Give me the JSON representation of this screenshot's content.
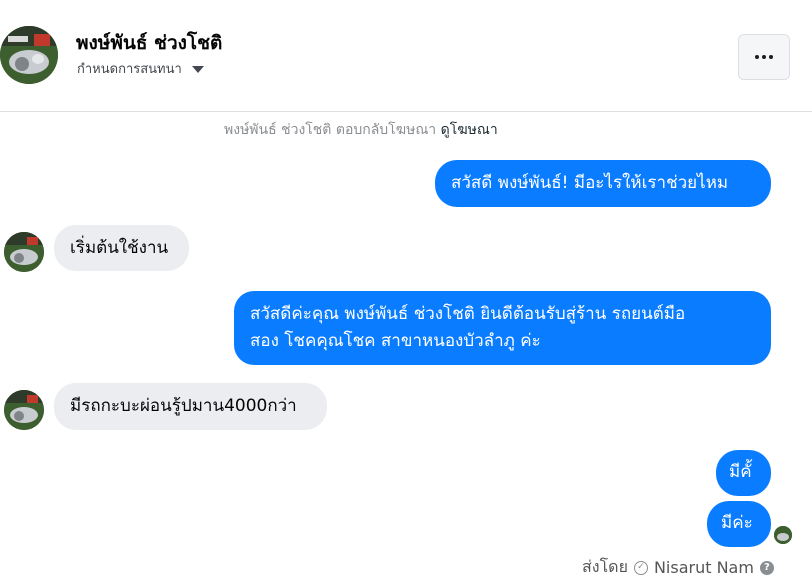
{
  "header": {
    "name": "พงษ์พันธ์ ช่วงโชติ",
    "subtitle": "กำหนดการสนทนา",
    "more_icon": "more-dots-icon"
  },
  "notice": {
    "text": "พงษ์พันธ์ ช่วงโชติ ตอบกลับโฆษณา",
    "link": "ดูโฆษณา"
  },
  "messages": [
    {
      "direction": "outgoing",
      "lines": [
        "สวัสดี พงษ์พันธ์! มีอะไรให้เราช่วยไหม"
      ]
    },
    {
      "direction": "incoming",
      "lines": [
        "เริ่มต้นใช้งาน"
      ]
    },
    {
      "direction": "outgoing",
      "lines": [
        "สวัสดีค่ะคุณ พงษ์พันธ์ ช่วงโชติ ยินดีต้อนรับสู่ร้าน รถยนต์มือ",
        "สอง โชคคุณโชค สาขาหนองบัวลำภู ค่ะ"
      ]
    },
    {
      "direction": "incoming",
      "lines": [
        "มีรถกะบะผ่อนรู้ปมาน4000กว่า"
      ]
    },
    {
      "direction": "outgoing",
      "lines": [
        "มีคั้"
      ]
    },
    {
      "direction": "outgoing",
      "lines": [
        "มีค่ะ"
      ]
    }
  ],
  "footer": {
    "sent_by": "ส่งโดย",
    "sender": "Nisarut Nam",
    "help_icon": "help-icon"
  },
  "colors": {
    "outgoing_bubble": "#0a7cff",
    "incoming_bubble": "#ebedf0"
  }
}
